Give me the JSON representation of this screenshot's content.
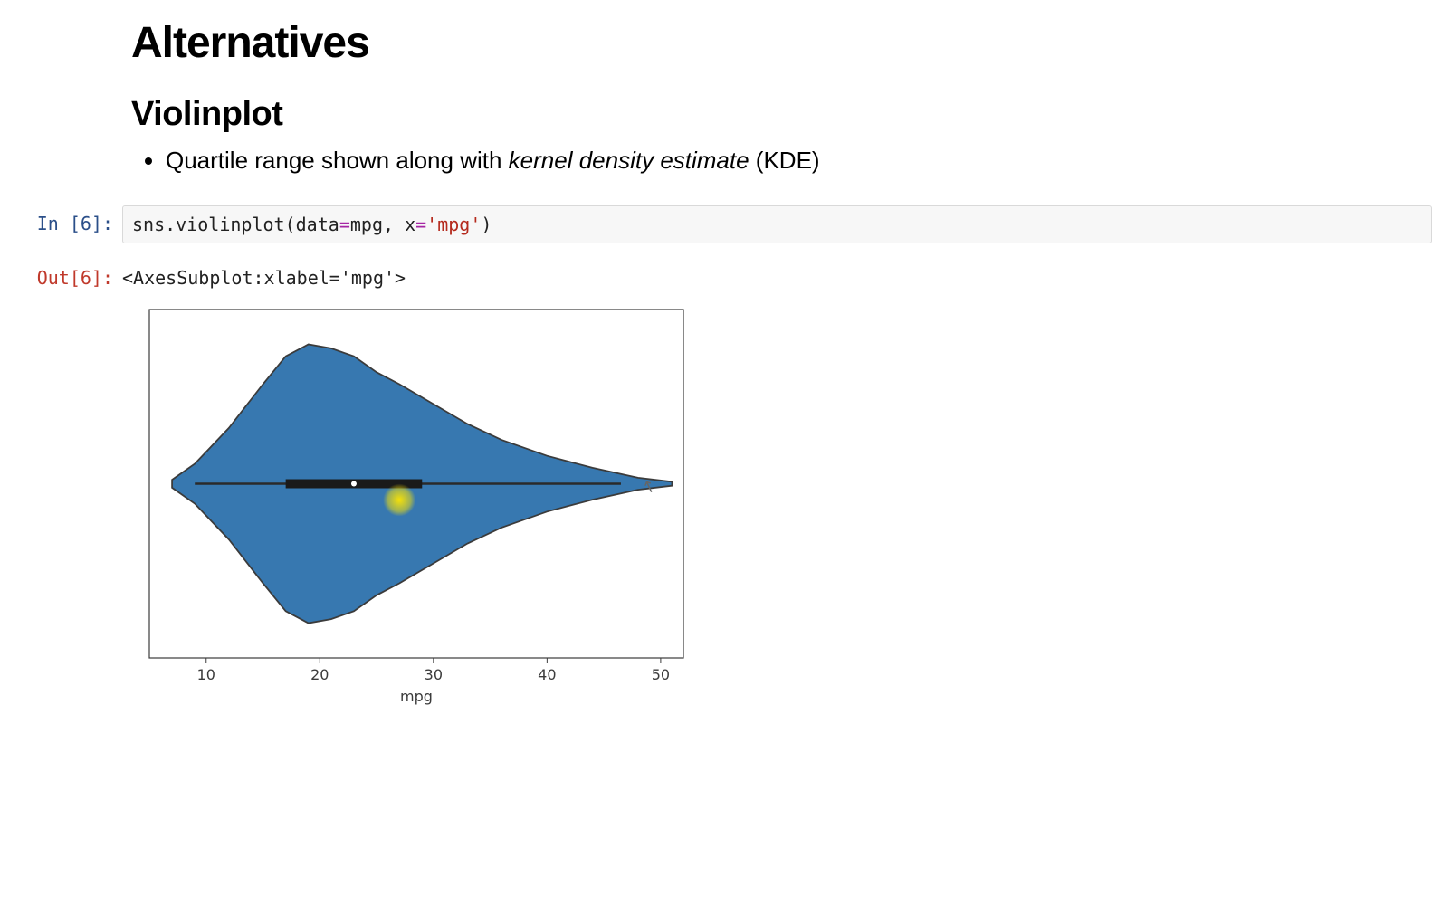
{
  "markdown": {
    "h1": "Alternatives",
    "h2": "Violinplot",
    "bullet_pre": "Quartile range shown along with ",
    "bullet_em": "kernel density estimate",
    "bullet_post": " (KDE)"
  },
  "cell": {
    "in_prompt": "In [6]:",
    "out_prompt": "Out[6]:",
    "code_tokens": {
      "t0": "sns",
      "t1": ".",
      "t2": "violinplot",
      "t3": "(",
      "t4": "data",
      "t5": "=",
      "t6": "mpg",
      "t7": ", ",
      "t8": "x",
      "t9": "=",
      "t10": "'mpg'",
      "t11": ")"
    },
    "output_repr": "<AxesSubplot:xlabel='mpg'>"
  },
  "chart_data": {
    "type": "violin",
    "xlabel": "mpg",
    "ylabel": "",
    "x_ticks": [
      10,
      20,
      30,
      40,
      50
    ],
    "x_range": [
      5,
      52
    ],
    "kde": {
      "x": [
        7,
        9,
        12,
        15,
        17,
        19,
        21,
        23,
        25,
        27,
        30,
        33,
        36,
        40,
        44,
        48,
        51
      ],
      "density": [
        0.002,
        0.01,
        0.028,
        0.05,
        0.064,
        0.07,
        0.068,
        0.064,
        0.056,
        0.05,
        0.04,
        0.03,
        0.022,
        0.014,
        0.008,
        0.003,
        0.001
      ]
    },
    "quartiles": {
      "q1": 17,
      "median": 23,
      "q3": 29
    },
    "whiskers": {
      "low": 9,
      "high": 46.5
    },
    "fill_color": "#3778b0",
    "stroke_color": "#3b3b3b",
    "highlight_marker_x": 27
  }
}
